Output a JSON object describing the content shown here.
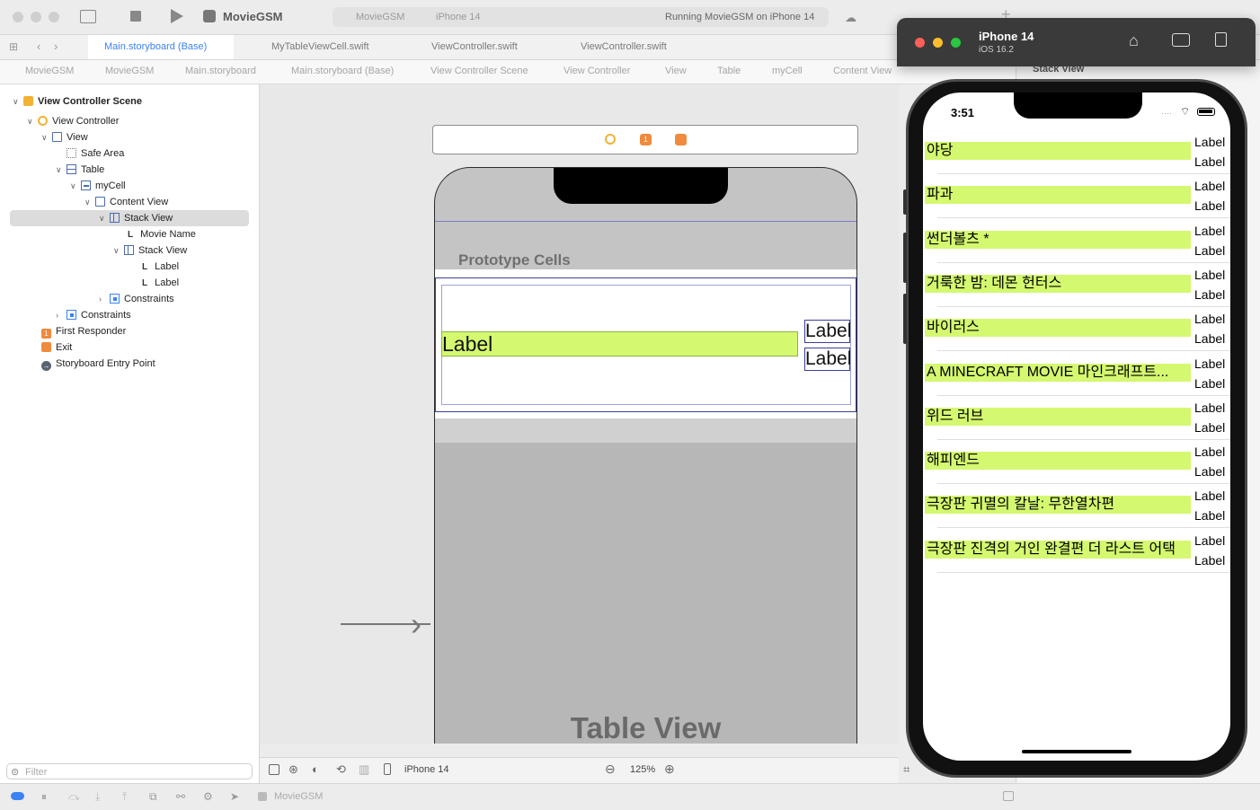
{
  "toolbar": {
    "app_name": "MovieGSM",
    "scheme": "MovieGSM",
    "destination": "iPhone 14",
    "status": "Running MovieGSM on iPhone 14"
  },
  "tabs": [
    {
      "label": "Main.storyboard (Base)"
    },
    {
      "label": "MyTableViewCell.swift"
    },
    {
      "label": "ViewController.swift"
    },
    {
      "label": "ViewController.swift"
    }
  ],
  "jumpbar": [
    "MovieGSM",
    "MovieGSM",
    "Main.storyboard",
    "Main.storyboard (Base)",
    "View Controller Scene",
    "View Controller",
    "View",
    "Table",
    "myCell",
    "Content View",
    "Stack View"
  ],
  "navigator": {
    "items": [
      {
        "label": "View Controller Scene",
        "bold": true
      },
      {
        "label": "View Controller"
      },
      {
        "label": "View"
      },
      {
        "label": "Safe Area"
      },
      {
        "label": "Table"
      },
      {
        "label": "myCell"
      },
      {
        "label": "Content View"
      },
      {
        "label": "Stack View"
      },
      {
        "label": "Movie Name"
      },
      {
        "label": "Stack View"
      },
      {
        "label": "Label"
      },
      {
        "label": "Label"
      },
      {
        "label": "Constraints"
      },
      {
        "label": "Constraints"
      },
      {
        "label": "First Responder"
      },
      {
        "label": "Exit"
      },
      {
        "label": "Storyboard Entry Point"
      }
    ],
    "filter_placeholder": "Filter"
  },
  "canvas": {
    "prototype_cells": "Prototype Cells",
    "cell_label": "Label",
    "right_label_1": "Label",
    "right_label_2": "Label",
    "table_view": "Table View",
    "device": "iPhone 14",
    "zoom": "125%"
  },
  "debug": {
    "target": "MovieGSM"
  },
  "inspector": {
    "header": "Stack View"
  },
  "simulator": {
    "device": "iPhone 14",
    "os": "iOS 16.2",
    "time": "3:51",
    "rows": [
      {
        "movie": "야당",
        "label1": "Label",
        "label2": "Label"
      },
      {
        "movie": "파과",
        "label1": "Label",
        "label2": "Label"
      },
      {
        "movie": "썬더볼츠 *",
        "label1": "Label",
        "label2": "Label"
      },
      {
        "movie": "거룩한 밤: 데몬 헌터스",
        "label1": "Label",
        "label2": "Label"
      },
      {
        "movie": "바이러스",
        "label1": "Label",
        "label2": "Label"
      },
      {
        "movie": "A MINECRAFT MOVIE 마인크래프트...",
        "label1": "Label",
        "label2": "Label"
      },
      {
        "movie": "위드 러브",
        "label1": "Label",
        "label2": "Label"
      },
      {
        "movie": "해피엔드",
        "label1": "Label",
        "label2": "Label"
      },
      {
        "movie": "극장판 귀멸의 칼날: 무한열차편",
        "label1": "Label",
        "label2": "Label"
      },
      {
        "movie": "극장판 진격의 거인 완결편 더 라스트 어택",
        "label1": "Label",
        "label2": "Label"
      }
    ]
  },
  "colors": {
    "accent": "#3b82f6",
    "cell_label_bg": "#d4f870"
  }
}
